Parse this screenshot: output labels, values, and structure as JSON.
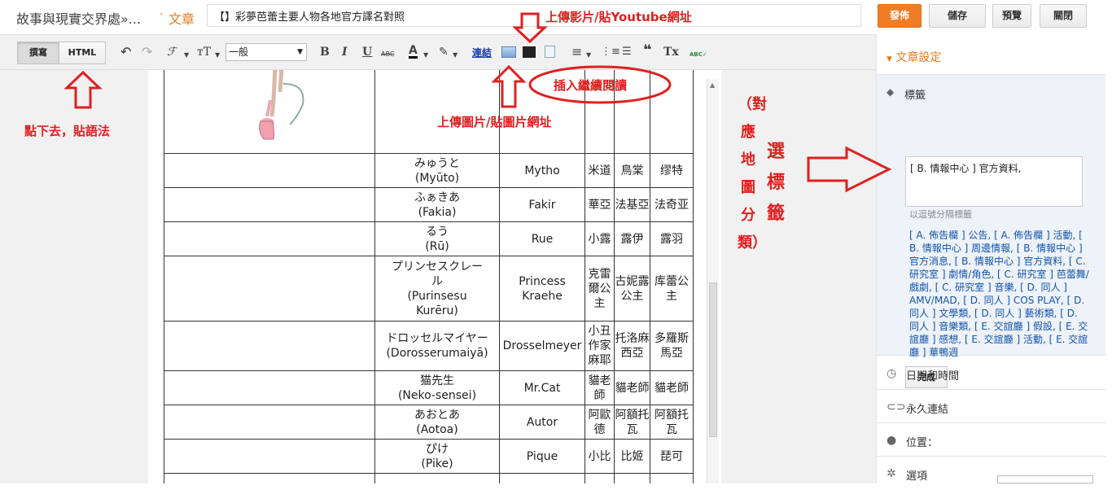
{
  "header": {
    "blog_name": "故事與現實交界處»...",
    "separator": "·",
    "section": "文章",
    "post_title": "【】彩夢芭蕾主要人物各地官方譯名對照",
    "publish_label": "發佈",
    "save_label": "儲存",
    "preview_label": "預覽",
    "close_label": "關閉",
    "accent_color": "#f07d25"
  },
  "toolbar": {
    "compose_label": "撰寫",
    "html_label": "HTML",
    "undo": "↶",
    "redo": "↷",
    "font_icon": "ℱ",
    "size_icon": "тT",
    "font_select": "一般",
    "bold": "B",
    "italic": "I",
    "underline": "U",
    "strike": "ABC",
    "text_color": "A",
    "highlight": "✎",
    "link_label": "連結",
    "image": "🖼",
    "video": "🎬",
    "jumpbreak": "📄",
    "align": "≡",
    "ol": "⋮≡",
    "ul": "☰",
    "quote": "❝",
    "clear": "Tx",
    "spellcheck": "ABC✓"
  },
  "table": {
    "rows": [
      {
        "jp": "みゅうと",
        "romaji": "(Myūto)",
        "en": "Mytho",
        "hk": "米道",
        "tw": "鳥棠",
        "cn": "缪特"
      },
      {
        "jp": "ふぁきあ",
        "romaji": "(Fakia)",
        "en": "Fakir",
        "hk": "華亞",
        "tw": "法基亞",
        "cn": "法奇亚"
      },
      {
        "jp": "るう",
        "romaji": "(Rū)",
        "en": "Rue",
        "hk": "小露",
        "tw": "露伊",
        "cn": "露羽"
      },
      {
        "jp": "プリンセスクレール",
        "romaji": "(Purinsesu Kurēru)",
        "en": "Princess Kraehe",
        "hk": "克雷爾公主",
        "tw": "古妮露公主",
        "cn": "库蕾公主"
      },
      {
        "jp": "ドロッセルマイヤー",
        "romaji": "(Dorosserumaiyā)",
        "en": "Drosselmeyer",
        "hk": "小丑作家麻耶",
        "tw": "托洛麻西亞",
        "cn": "多羅斯馬亞"
      },
      {
        "jp": "猫先生",
        "romaji": "(Neko-sensei)",
        "en": "Mr.Cat",
        "hk": "貓老師",
        "tw": "貓老師",
        "cn": "貓老師"
      },
      {
        "jp": "あおとあ",
        "romaji": "(Aotoa)",
        "en": "Autor",
        "hk": "阿歐德",
        "tw": "阿額托瓦",
        "cn": "阿額托瓦"
      },
      {
        "jp": "ぴけ",
        "romaji": "(Pike)",
        "en": "Pique",
        "hk": "小比",
        "tw": "比姬",
        "cn": "琵可"
      }
    ]
  },
  "sidebar": {
    "settings_title": "文章設定",
    "labels_title": "標籤",
    "label_value": "[ B. 情報中心 ] 官方資料,",
    "label_hint": "以逗號分隔標籤",
    "label_list": "[ A. 佈告欄 ] 公告, [ A. 佈告欄 ] 活動, [ B. 情報中心 ] 周邊情報, [ B. 情報中心 ] 官方消息, [ B. 情報中心 ] 官方資料, [ C. 研究室 ] 劇情/角色, [ C. 研究室 ] 芭蕾舞/戲劇, [ C. 研究室 ] 音樂, [ D. 同人 ] AMV/MAD, [ D. 同人 ] COS PLAY, [ D. 同人 ] 文學類, [ D. 同人 ] 藝術類, [ D. 同人 ] 音樂類, [ E. 交誼廳 ] 假設, [ E. 交誼廳 ] 感想, [ E. 交誼廳 ] 活動, [ E. 交誼廳 ] 華鴨週",
    "done_label": "完成",
    "datetime_label": "日期和時間",
    "permalink_label": "永久連結",
    "location_label": "位置：",
    "options_label": "選項"
  },
  "annotations": {
    "paste_code": "點下去，貼語法",
    "upload_video": "上傳影片/貼Youtube網址",
    "upload_image": "上傳圖片/貼圖片網址",
    "insert_readmore": "插入繼續閱讀",
    "map_category": "（對應地圖分類）",
    "select_label": "選標籤",
    "annotation_color": "#e02020"
  }
}
